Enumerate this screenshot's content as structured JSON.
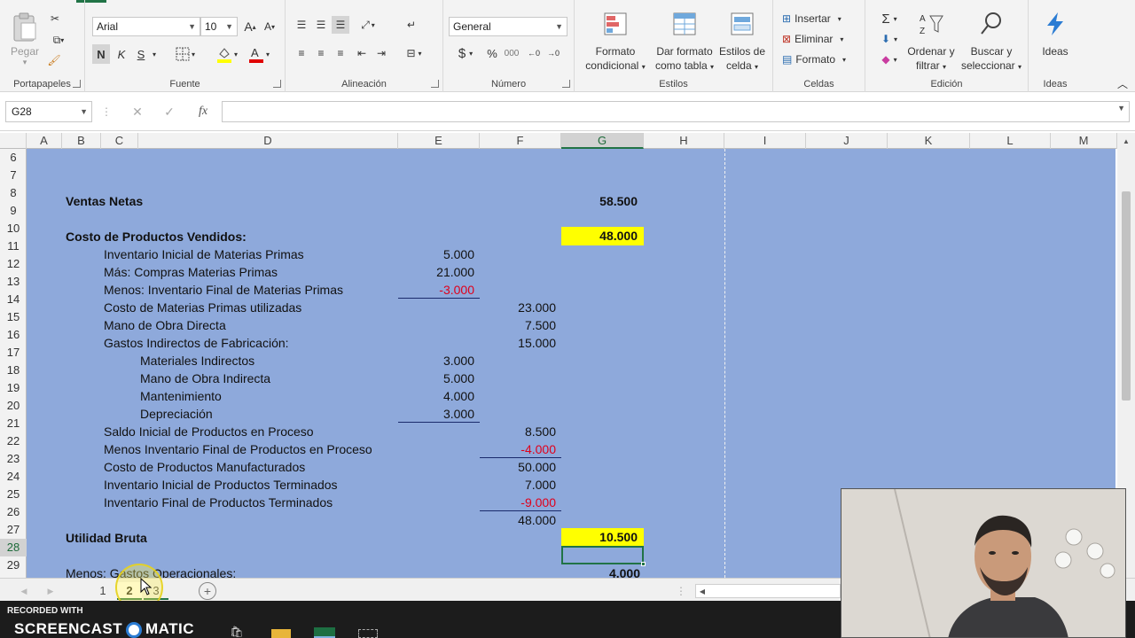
{
  "ribbon": {
    "clipboard": {
      "paste": "Pegar",
      "label": "Portapapeles"
    },
    "font": {
      "name": "Arial",
      "size": "10",
      "bold": "N",
      "italic": "K",
      "underline": "S",
      "label": "Fuente"
    },
    "alignment": {
      "label": "Alineación"
    },
    "number": {
      "format": "General",
      "currency": "$",
      "percent": "%",
      "thousands": "000",
      "label": "Número"
    },
    "styles": {
      "conditional_l1": "Formato",
      "conditional_l2": "condicional",
      "table_l1": "Dar formato",
      "table_l2": "como tabla",
      "cell_l1": "Estilos de",
      "cell_l2": "celda",
      "label": "Estilos"
    },
    "cells": {
      "insert": "Insertar",
      "delete": "Eliminar",
      "format": "Formato",
      "label": "Celdas"
    },
    "editing": {
      "sort_l1": "Ordenar y",
      "sort_l2": "filtrar",
      "find_l1": "Buscar y",
      "find_l2": "seleccionar",
      "label": "Edición"
    },
    "ideas": {
      "button": "Ideas",
      "label": "Ideas"
    }
  },
  "formula_bar": {
    "name_box": "G28",
    "cancel": "✕",
    "enter": "✓",
    "fx": "fx",
    "value": ""
  },
  "columns": [
    "A",
    "B",
    "C",
    "D",
    "E",
    "F",
    "G",
    "H",
    "I",
    "J",
    "K",
    "L",
    "M"
  ],
  "selected_column": "G",
  "rows": [
    "6",
    "7",
    "8",
    "9",
    "10",
    "11",
    "12",
    "13",
    "14",
    "15",
    "16",
    "17",
    "18",
    "19",
    "20",
    "21",
    "22",
    "23",
    "24",
    "25",
    "26",
    "27",
    "28",
    "29"
  ],
  "selected_row": "28",
  "cells": {
    "r8_label": "Ventas Netas",
    "r8_g": "58.500",
    "r10_label": "Costo de Productos Vendidos:",
    "r10_g": "48.000",
    "r11_label": "Inventario Inicial de Materias Primas",
    "r11_e": "5.000",
    "r12_label": "Más: Compras Materias Primas",
    "r12_e": "21.000",
    "r13_label": "Menos: Inventario Final de Materias Primas",
    "r13_e": "-3.000",
    "r14_label": "Costo de Materias Primas utilizadas",
    "r14_f": "23.000",
    "r15_label": "Mano de Obra Directa",
    "r15_f": "7.500",
    "r16_label": "Gastos Indirectos de Fabricación:",
    "r16_f": "15.000",
    "r17_label": "Materiales Indirectos",
    "r17_e": "3.000",
    "r18_label": "Mano de Obra Indirecta",
    "r18_e": "5.000",
    "r19_label": "Mantenimiento",
    "r19_e": "4.000",
    "r20_label": "Depreciación",
    "r20_e": "3.000",
    "r21_label": "Saldo Inicial de Productos en Proceso",
    "r21_f": "8.500",
    "r22_label": "Menos Inventario Final de Productos en Proceso",
    "r22_f": "-4.000",
    "r23_label": "Costo de Productos Manufacturados",
    "r23_f": "50.000",
    "r24_label": "Inventario Inicial de Productos Terminados",
    "r24_f": "7.000",
    "r25_label": "Inventario Final de Productos Terminados",
    "r25_f": "-9.000",
    "r26_f": "48.000",
    "r27_label": "Utilidad Bruta",
    "r27_g": "10.500",
    "r29_label": "Menos: Gastos Operacionales:",
    "r29_g": "4.000"
  },
  "sheet_tabs": [
    "1",
    "2",
    "3"
  ],
  "active_tab": "2",
  "watermark": {
    "recorded": "RECORDED WITH",
    "brand_a": "SCREENCAST",
    "brand_b": "MATIC"
  },
  "colors": {
    "sheet_fill": "#8ea9db",
    "highlight": "#ffff00",
    "negative": "#e0001b",
    "excel_green": "#217346"
  }
}
